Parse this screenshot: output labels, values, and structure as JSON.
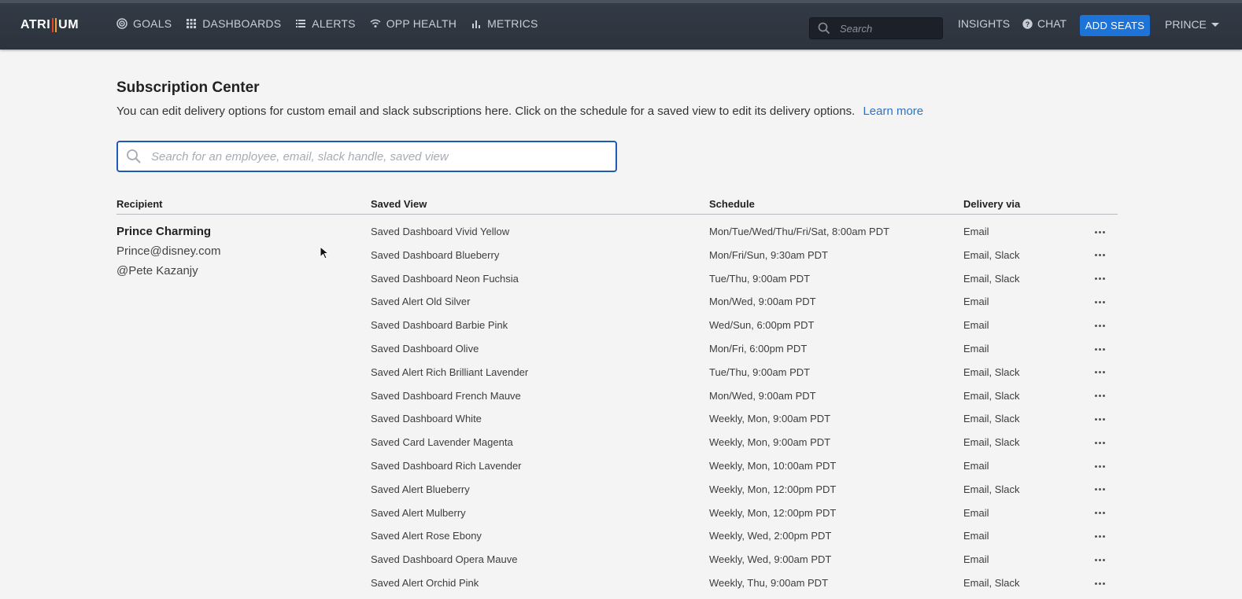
{
  "brand": {
    "logo_left": "ATRI",
    "logo_right": "UM",
    "bar_colors": [
      "#e6432c",
      "#f2a22c",
      "#ffffff"
    ]
  },
  "nav": {
    "items": [
      {
        "label": "GOALS",
        "icon": "target-icon"
      },
      {
        "label": "DASHBOARDS",
        "icon": "grid-icon"
      },
      {
        "label": "ALERTS",
        "icon": "list-icon"
      },
      {
        "label": "OPP HEALTH",
        "icon": "signal-icon"
      },
      {
        "label": "METRICS",
        "icon": "bar-chart-icon"
      }
    ],
    "search_placeholder": "Search",
    "insights": "INSIGHTS",
    "chat": "CHAT",
    "add_seats": "ADD SEATS",
    "user": "PRINCE"
  },
  "page": {
    "title": "Subscription Center",
    "subtitle": "You can edit delivery options for custom email and slack subscriptions here. Click on the schedule for a saved view to edit its delivery options.",
    "learn_more": "Learn more",
    "search_placeholder": "Search for an employee, email, slack handle, saved view"
  },
  "table": {
    "headers": {
      "recipient": "Recipient",
      "saved_view": "Saved View",
      "schedule": "Schedule",
      "delivery": "Delivery via"
    },
    "recipient": {
      "name": "Prince Charming",
      "email": "Prince@disney.com",
      "slack": "@Pete Kazanjy"
    },
    "rows": [
      {
        "view": "Saved Dashboard Vivid Yellow",
        "schedule": "Mon/Tue/Wed/Thu/Fri/Sat, 8:00am PDT",
        "delivery": "Email"
      },
      {
        "view": "Saved Dashboard Blueberry",
        "schedule": "Mon/Fri/Sun, 9:30am PDT",
        "delivery": "Email, Slack"
      },
      {
        "view": "Saved Dashboard Neon Fuchsia",
        "schedule": "Tue/Thu, 9:00am PDT",
        "delivery": "Email, Slack"
      },
      {
        "view": "Saved Alert Old Silver",
        "schedule": "Mon/Wed, 9:00am PDT",
        "delivery": "Email"
      },
      {
        "view": "Saved Dashboard Barbie Pink",
        "schedule": "Wed/Sun, 6:00pm PDT",
        "delivery": "Email"
      },
      {
        "view": "Saved Dashboard Olive",
        "schedule": "Mon/Fri, 6:00pm PDT",
        "delivery": "Email"
      },
      {
        "view": "Saved Alert Rich Brilliant Lavender",
        "schedule": "Tue/Thu, 9:00am PDT",
        "delivery": "Email, Slack"
      },
      {
        "view": "Saved Dashboard French Mauve",
        "schedule": "Mon/Wed, 9:00am PDT",
        "delivery": "Email, Slack"
      },
      {
        "view": "Saved Dashboard White",
        "schedule": "Weekly, Mon, 9:00am PDT",
        "delivery": "Email, Slack"
      },
      {
        "view": "Saved Card Lavender Magenta",
        "schedule": "Weekly, Mon, 9:00am PDT",
        "delivery": "Email, Slack"
      },
      {
        "view": "Saved Dashboard Rich Lavender",
        "schedule": "Weekly, Mon, 10:00am PDT",
        "delivery": "Email"
      },
      {
        "view": "Saved Alert Blueberry",
        "schedule": "Weekly, Mon, 12:00pm PDT",
        "delivery": "Email, Slack"
      },
      {
        "view": "Saved Alert Mulberry",
        "schedule": "Weekly, Mon, 12:00pm PDT",
        "delivery": "Email"
      },
      {
        "view": "Saved Alert Rose Ebony",
        "schedule": "Weekly, Wed, 2:00pm PDT",
        "delivery": "Email"
      },
      {
        "view": "Saved Dashboard Opera Mauve",
        "schedule": "Weekly, Wed, 9:00am PDT",
        "delivery": "Email"
      },
      {
        "view": "Saved Alert Orchid Pink",
        "schedule": "Weekly, Thu, 9:00am PDT",
        "delivery": "Email, Slack"
      }
    ]
  },
  "colors": {
    "accent": "#1e73d8",
    "link": "#2a73c7",
    "topbar": "#2c333d"
  }
}
